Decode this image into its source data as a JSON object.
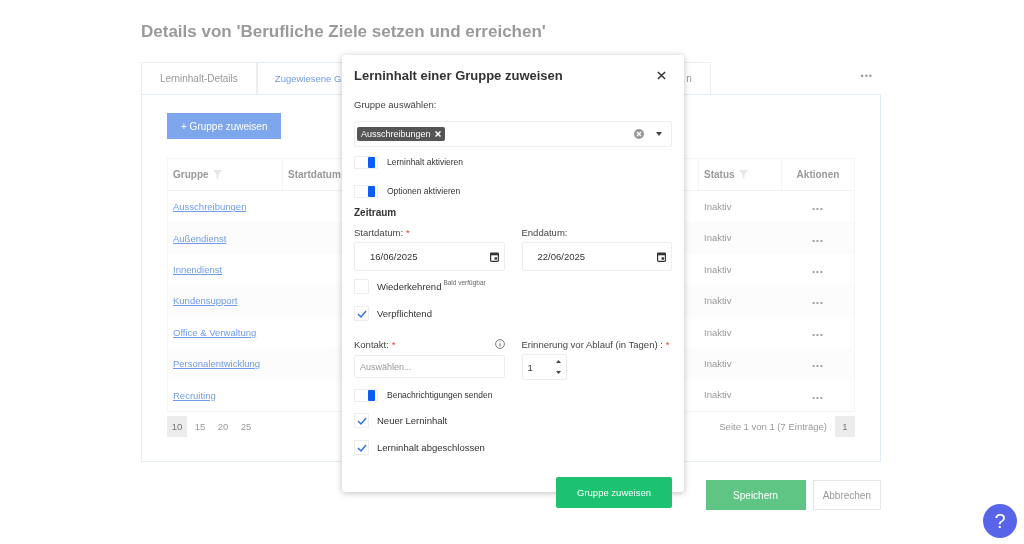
{
  "page": {
    "title": "Details von 'Berufliche Ziele setzen und erreichen'",
    "more": "•••",
    "tabs": [
      {
        "label": "Lerninhalt-Details",
        "selected": false
      },
      {
        "label": "Zugewiesene G",
        "selected": true
      },
      {
        "label": "n",
        "selected": false
      }
    ],
    "assign_button": "+ Gruppe zuweisen",
    "table": {
      "columns": [
        {
          "label": "Gruppe",
          "filter": true
        },
        {
          "label": "Startdatum"
        },
        {
          "label": "Status",
          "filter": true
        },
        {
          "label": "Aktionen",
          "filter": false
        }
      ],
      "rows": [
        {
          "group": "Ausschreibungen",
          "status": "Inaktiv",
          "actions": "•••"
        },
        {
          "group": "Außendienst",
          "status": "Inaktiv",
          "actions": "•••"
        },
        {
          "group": "Innendienst",
          "status": "Inaktiv",
          "actions": "•••"
        },
        {
          "group": "Kundensupport",
          "status": "Inaktiv",
          "actions": "•••"
        },
        {
          "group": "Office & Verwaltung",
          "status": "Inaktiv",
          "actions": "•••"
        },
        {
          "group": "Personalentwicklung",
          "status": "Inaktiv",
          "actions": "•••"
        },
        {
          "group": "Recruiting",
          "status": "Inaktiv",
          "actions": "•••"
        }
      ]
    },
    "page_sizes": [
      {
        "label": "10",
        "selected": true
      },
      {
        "label": "15",
        "selected": false
      },
      {
        "label": "20",
        "selected": false
      },
      {
        "label": "25",
        "selected": false
      }
    ],
    "page_info": "Seite 1 von 1 (7 Einträge)",
    "pages": [
      {
        "label": "1",
        "selected": true
      }
    ],
    "save_button": "Speichern",
    "cancel_button": "Abbrechen",
    "help": "?"
  },
  "modal": {
    "title": "Lerninhalt einer Gruppe zuweisen",
    "group_label": "Gruppe auswählen:",
    "selected_groups": [
      {
        "label": "Ausschreibungen"
      }
    ],
    "top_options": [
      {
        "label": "Lerninhalt aktivieren",
        "on": true
      },
      {
        "label": "Optionen aktivieren",
        "on": true
      }
    ],
    "period_heading": "Zeitraum",
    "start": {
      "label": "Startdatum:",
      "required_mark": "*",
      "value": "16/06/2025"
    },
    "end": {
      "label": "Enddatum:",
      "value": "22/06/2025"
    },
    "checks": [
      {
        "label": "Wiederkehrend",
        "note": "Bald verfügbar",
        "checked": false
      },
      {
        "label": "Verpflichtend",
        "checked": true
      }
    ],
    "contact": {
      "label": "Kontakt:",
      "required_mark": "*",
      "placeholder": "Auswählen..."
    },
    "reminder": {
      "label": "Erinnerung vor Ablauf (in Tagen) :",
      "required_mark": "*",
      "value": "1"
    },
    "notify": {
      "label": "Benachrichtigungen senden",
      "on": true
    },
    "notify_checks": [
      {
        "label": "Neuer Lerninhalt",
        "checked": true
      },
      {
        "label": "Lerninhalt abgeschlossen",
        "checked": true
      }
    ],
    "submit": "Gruppe zuweisen"
  }
}
